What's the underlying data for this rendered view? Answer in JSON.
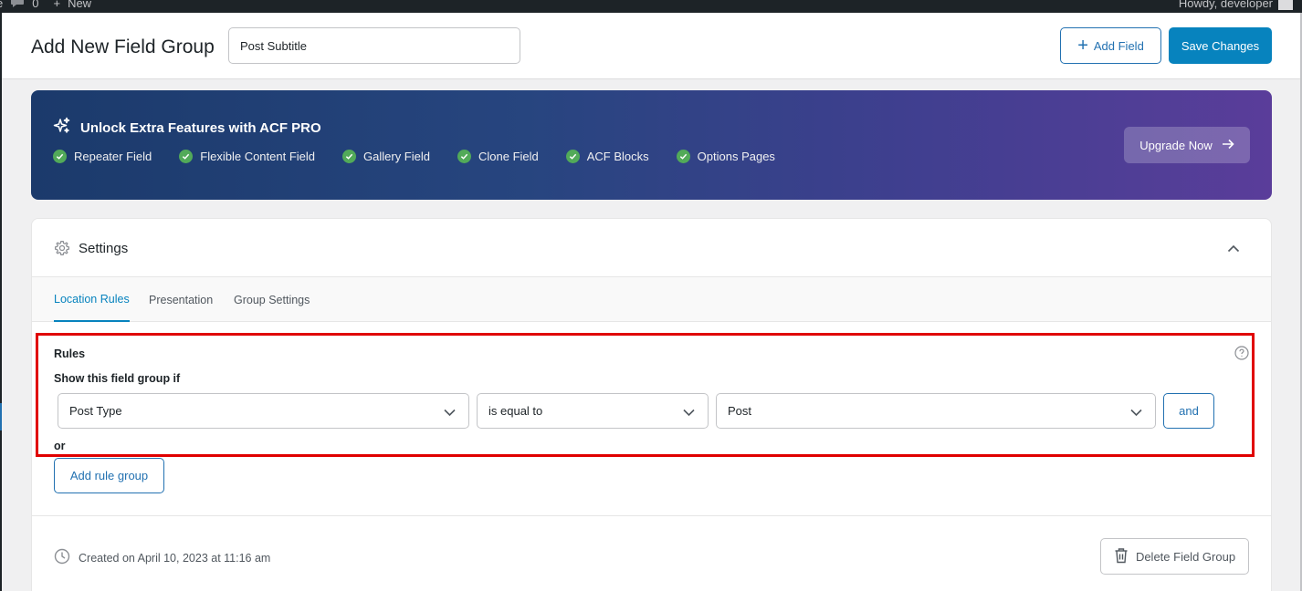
{
  "admin_bar": {
    "left_fragment": "e",
    "comments_count": "0",
    "new_label": "New",
    "greeting": "Howdy, developer"
  },
  "header": {
    "title": "Add New Field Group",
    "title_value": "Post Subtitle",
    "add_field_label": "Add Field",
    "save_label": "Save Changes"
  },
  "promo": {
    "title": "Unlock Extra Features with ACF PRO",
    "features": [
      "Repeater Field",
      "Flexible Content Field",
      "Gallery Field",
      "Clone Field",
      "ACF Blocks",
      "Options Pages"
    ],
    "upgrade_label": "Upgrade Now"
  },
  "settings": {
    "title": "Settings",
    "tabs": [
      "Location Rules",
      "Presentation",
      "Group Settings"
    ],
    "rules": {
      "label": "Rules",
      "show_if": "Show this field group if",
      "param": "Post Type",
      "operator": "is equal to",
      "value": "Post",
      "and_label": "and",
      "or_label": "or",
      "add_rule_group_label": "Add rule group"
    },
    "created": "Created on April 10, 2023 at 11:16 am",
    "delete_label": "Delete Field Group"
  },
  "colors": {
    "accent": "#0783be",
    "link": "#2271b1",
    "check": "#52aa59",
    "highlight": "#e00000"
  }
}
